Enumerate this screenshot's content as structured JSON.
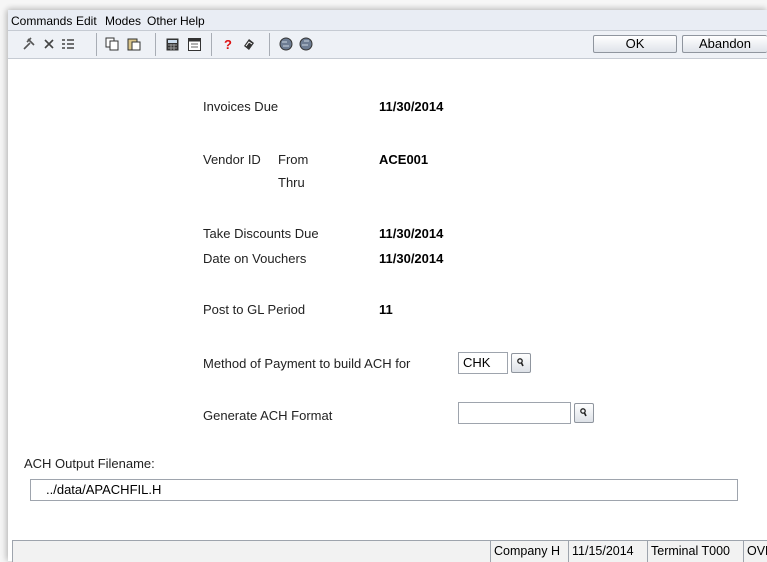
{
  "menu": {
    "commands": "Commands",
    "edit": "Edit",
    "modes": "Modes",
    "other": "Other",
    "help": "Help"
  },
  "toolbar": {
    "ok_label": "OK",
    "abandon_label": "Abandon",
    "icons": [
      "tools-icon",
      "delete-icon",
      "list-icon",
      "copy-icon",
      "paste-icon",
      "calculator-icon",
      "calendar-icon",
      "help-icon",
      "notes-icon",
      "globe-back-icon",
      "globe-forward-icon"
    ]
  },
  "form": {
    "invoices_due_label": "Invoices Due",
    "invoices_due_value": "11/30/2014",
    "vendor_id_label": "Vendor ID",
    "from_label": "From",
    "from_value": "ACE001",
    "thru_label": "Thru",
    "thru_value": "",
    "take_discounts_label": "Take Discounts Due",
    "take_discounts_value": "11/30/2014",
    "date_on_vouchers_label": "Date on Vouchers",
    "date_on_vouchers_value": "11/30/2014",
    "post_gl_label": "Post to GL Period",
    "post_gl_value": "11",
    "method_payment_label": "Method of Payment to build ACH for",
    "method_payment_value": "CHK",
    "generate_ach_label": "Generate ACH Format",
    "generate_ach_value": "",
    "ach_output_label": "ACH Output Filename:",
    "ach_output_value": "../data/APACHFIL.H"
  },
  "status": {
    "message": "",
    "company": "Company H",
    "date": "11/15/2014",
    "terminal": "Terminal T000",
    "mode": "OVR"
  }
}
